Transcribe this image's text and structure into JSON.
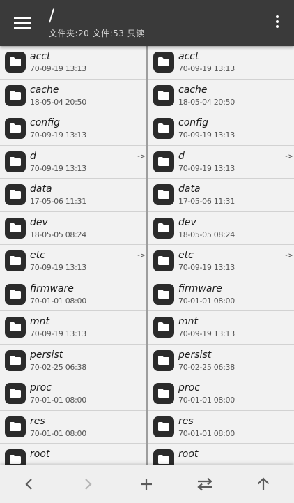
{
  "header": {
    "path": "/",
    "subtitle": "文件夹:20 文件:53 只读"
  },
  "panes": {
    "left": [
      {
        "name": "acct",
        "date": "70-09-19 13:13",
        "link": ""
      },
      {
        "name": "cache",
        "date": "18-05-04 20:50",
        "link": ""
      },
      {
        "name": "config",
        "date": "70-09-19 13:13",
        "link": ""
      },
      {
        "name": "d",
        "date": "70-09-19 13:13",
        "link": "->"
      },
      {
        "name": "data",
        "date": "17-05-06 11:31",
        "link": ""
      },
      {
        "name": "dev",
        "date": "18-05-05 08:24",
        "link": ""
      },
      {
        "name": "etc",
        "date": "70-09-19 13:13",
        "link": "->"
      },
      {
        "name": "firmware",
        "date": "70-01-01 08:00",
        "link": ""
      },
      {
        "name": "mnt",
        "date": "70-09-19 13:13",
        "link": ""
      },
      {
        "name": "persist",
        "date": "70-02-25 06:38",
        "link": ""
      },
      {
        "name": "proc",
        "date": "70-01-01 08:00",
        "link": ""
      },
      {
        "name": "res",
        "date": "70-01-01 08:00",
        "link": ""
      },
      {
        "name": "root",
        "date": "",
        "link": ""
      }
    ],
    "right": [
      {
        "name": "acct",
        "date": "70-09-19 13:13",
        "link": ""
      },
      {
        "name": "cache",
        "date": "18-05-04 20:50",
        "link": ""
      },
      {
        "name": "config",
        "date": "70-09-19 13:13",
        "link": ""
      },
      {
        "name": "d",
        "date": "70-09-19 13:13",
        "link": "->"
      },
      {
        "name": "data",
        "date": "17-05-06 11:31",
        "link": ""
      },
      {
        "name": "dev",
        "date": "18-05-05 08:24",
        "link": ""
      },
      {
        "name": "etc",
        "date": "70-09-19 13:13",
        "link": "->"
      },
      {
        "name": "firmware",
        "date": "70-01-01 08:00",
        "link": ""
      },
      {
        "name": "mnt",
        "date": "70-09-19 13:13",
        "link": ""
      },
      {
        "name": "persist",
        "date": "70-02-25 06:38",
        "link": ""
      },
      {
        "name": "proc",
        "date": "70-01-01 08:00",
        "link": ""
      },
      {
        "name": "res",
        "date": "70-01-01 08:00",
        "link": ""
      },
      {
        "name": "root",
        "date": "",
        "link": ""
      }
    ]
  },
  "icons": {
    "menu": "hamburger-menu-icon",
    "more": "more-vertical-icon",
    "folder": "folder-icon",
    "back": "chevron-left-icon",
    "forward": "chevron-right-icon",
    "add": "plus-icon",
    "swap": "swap-arrows-icon",
    "up": "arrow-up-icon"
  },
  "colors": {
    "toolbar": "#3a3a3a",
    "icon_tile": "#2b2b2b",
    "pane_bg": "#f2f2f2",
    "divider": "#9e9e9e",
    "disabled": "#b5b5b5"
  }
}
